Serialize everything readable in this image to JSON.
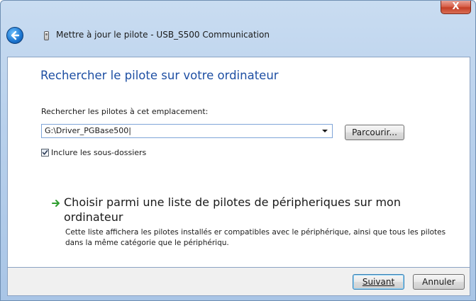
{
  "window": {
    "close_label": "X",
    "title": "Mettre à jour le pilote - USB_S500 Communication"
  },
  "main": {
    "heading": "Rechercher le pilote sur votre ordinateur",
    "location_label": "Rechercher les pilotes à cet emplacement:",
    "path_value": "G:\\Driver_PGBase500|",
    "browse_label": "Parcourir...",
    "include_subfolders_label": "Inclure les sous-dossiers",
    "include_subfolders_checked": true,
    "option_title": "Choisir parmi une liste de pilotes de péripheriques sur mon ordinateur",
    "option_desc": "Cette liste affichera les pilotes installés er compatibles avec le périphérique, ainsi que tous les pilotes dans la même catégorie que le périphériqu."
  },
  "footer": {
    "next_label": "Suivant",
    "cancel_label": "Annuler"
  },
  "icons": {
    "back": "back-arrow-icon",
    "device": "device-icon",
    "option_arrow": "green-arrow-icon",
    "check": "checkmark-icon"
  },
  "colors": {
    "heading": "#1e4fa3",
    "close_button": "#c43f26",
    "option_arrow": "#2f9e2f"
  }
}
